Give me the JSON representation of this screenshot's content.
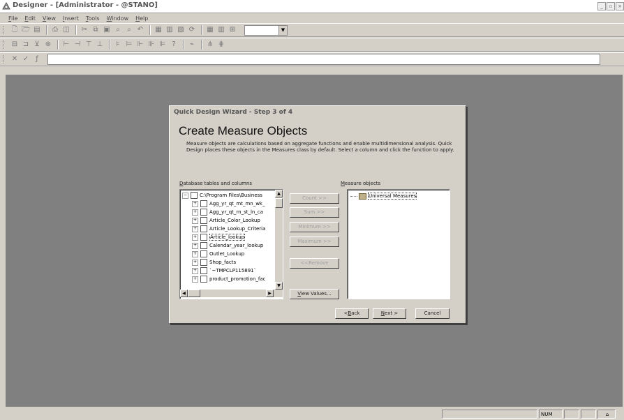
{
  "window": {
    "title": "Designer - [Administrator - @STANO]"
  },
  "menu": [
    {
      "mnemonic": "F",
      "rest": "ile"
    },
    {
      "mnemonic": "E",
      "rest": "dit"
    },
    {
      "mnemonic": "V",
      "rest": "iew"
    },
    {
      "mnemonic": "I",
      "rest": "nsert"
    },
    {
      "mnemonic": "T",
      "rest": "ools"
    },
    {
      "mnemonic": "W",
      "rest": "indow"
    },
    {
      "mnemonic": "H",
      "rest": "elp"
    }
  ],
  "formula_bar": {
    "cancel_glyph": "✕",
    "accept_glyph": "✓",
    "fx_glyph": "ƒ"
  },
  "dialog": {
    "title": "Quick Design Wizard - Step 3 of 4",
    "heading": "Create Measure Objects",
    "description": "Measure objects are calculations based on aggregate functions and enable multidimensional analysis. Quick Design places these objects in the Measures class by default. Select a column and click the function to apply.",
    "left_label_mnemonic": "D",
    "left_label_rest": "atabase tables and columns",
    "right_label_mnemonic": "M",
    "right_label_rest": "easure objects",
    "tree": {
      "root": "C:\\Program Files\\Business",
      "items": [
        "Agg_yr_qt_mt_mn_wk_",
        "Agg_yr_qt_rn_st_ln_ca",
        "Article_Color_Lookup",
        "Article_Lookup_Criteria",
        "Article_lookup",
        "Calendar_year_lookup",
        "Outlet_Lookup",
        "Shop_facts",
        "`~TMPCLP115891`",
        "product_promotion_fac"
      ]
    },
    "measures_root": "Universal Measures",
    "buttons": {
      "count": "Count >>",
      "sum": "Sum >>",
      "minimum": "Minimum >>",
      "maximum": "Maximum >>",
      "remove": "<<Remove",
      "view_values_mnemonic": "V",
      "view_values_rest": "iew Values...",
      "back_pre": "<",
      "back_mnemonic": "B",
      "back_rest": "ack",
      "next_mnemonic": "N",
      "next_rest": "ext >",
      "cancel": "Cancel"
    }
  },
  "statusbar": {
    "num": "NUM"
  },
  "colors": {
    "workspace": "#808080",
    "chrome": "#d4d0c8"
  }
}
